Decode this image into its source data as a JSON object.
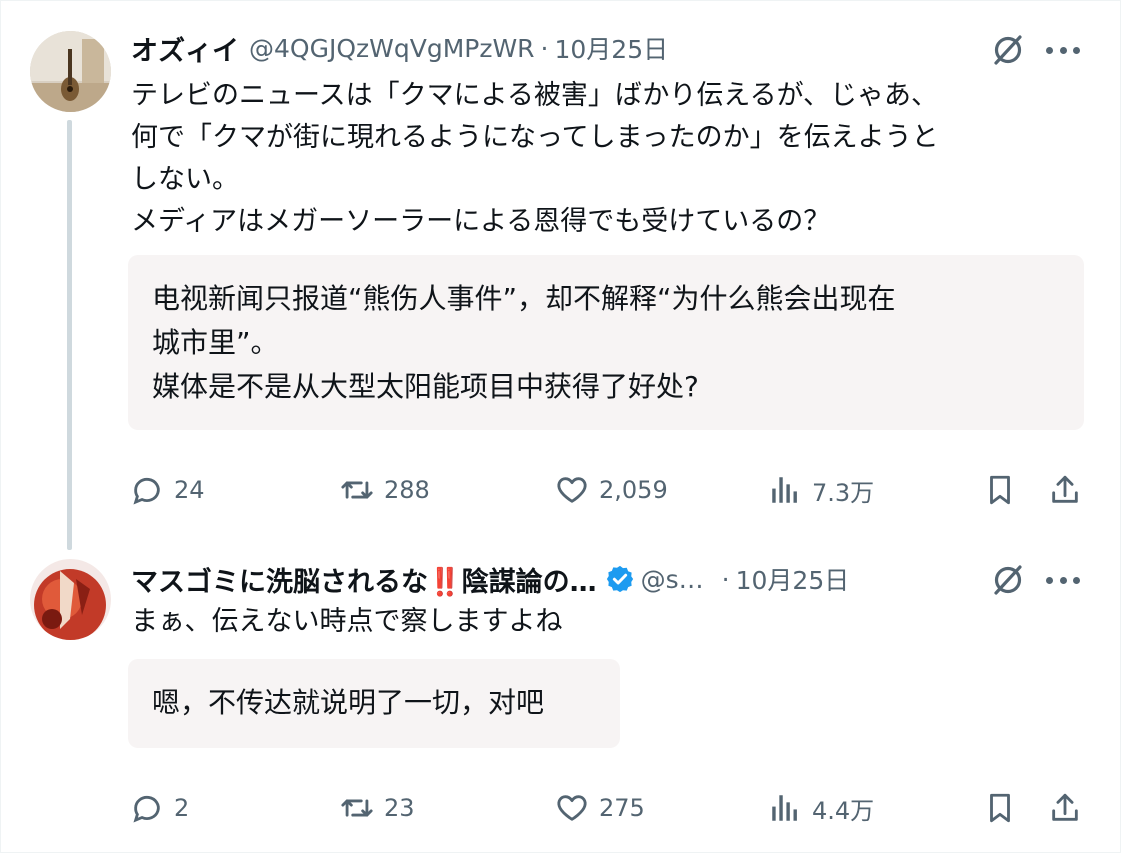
{
  "tweets": [
    {
      "name": "オズィイ",
      "handle": "@4QGJQzWqVgMPzWR",
      "separator": "·",
      "date": "10月25日",
      "text": "テレビのニュースは「クマによる被害」ばかり伝えるが、じゃあ、\n何で「クマが街に現れるようになってしまったのか」を伝えようと\nしない。\nメディアはメガーソーラーによる恩得でも受けているの？",
      "translation": "电视新闻只报道“熊伤人事件”，却不解释“为什么熊会出现在\n城市里”。\n媒体是不是从大型太阳能项目中获得了好处?",
      "stats": {
        "replies": "24",
        "reposts": "288",
        "likes": "2,059",
        "views": "7.3万"
      }
    },
    {
      "name": "マスゴミに洗脳されるな‼️陰謀論の…",
      "handle": "@s…",
      "separator": "·",
      "date": "10月25日",
      "text": "まぁ、伝えない時点で察しますよね",
      "translation": "嗯，不传达就说明了一切，对吧",
      "stats": {
        "replies": "2",
        "reposts": "23",
        "likes": "275",
        "views": "4.4万"
      }
    }
  ],
  "colors": {
    "text": "#0f1419",
    "secondary": "#536471",
    "verified": "#1d9bf0",
    "translation_bg": "#f7f4f4",
    "thread_line": "#cfd9de"
  },
  "icons": [
    "reply-icon",
    "repost-icon",
    "like-icon",
    "views-icon",
    "bookmark-icon",
    "share-icon",
    "grok-icon",
    "more-icon",
    "verified-badge-icon"
  ]
}
